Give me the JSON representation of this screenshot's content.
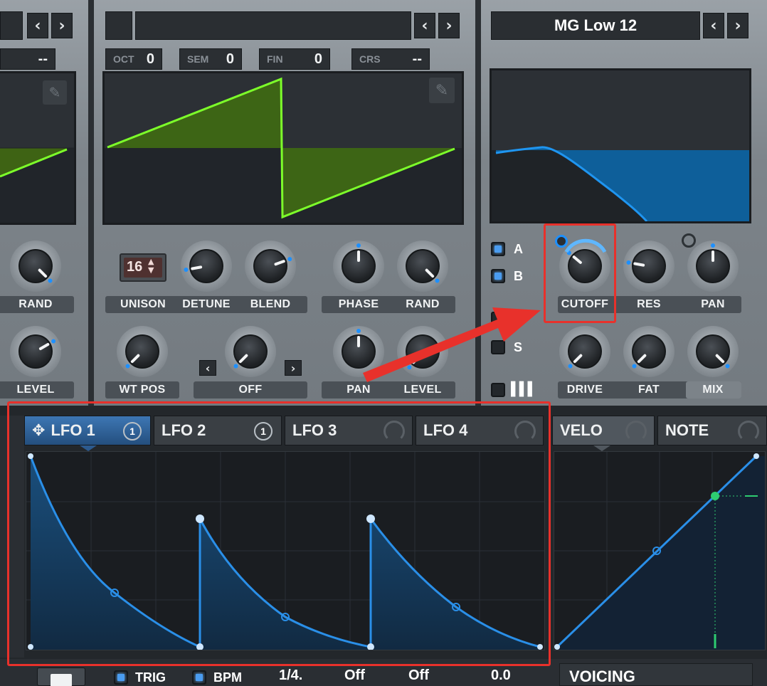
{
  "osc_left": {
    "detail_value": "--",
    "rand_label": "RAND",
    "level_label": "LEVEL"
  },
  "osc_b": {
    "fields": [
      {
        "key": "OCT",
        "value": "0"
      },
      {
        "key": "SEM",
        "value": "0"
      },
      {
        "key": "FIN",
        "value": "0"
      },
      {
        "key": "CRS",
        "value": "--"
      }
    ],
    "unison_value": "16",
    "labels_row1": [
      "UNISON",
      "DETUNE",
      "BLEND",
      "PHASE",
      "RAND"
    ],
    "labels_row2": [
      "WT POS",
      "OFF",
      "PAN",
      "LEVEL"
    ]
  },
  "filter": {
    "preset_name": "MG Low 12",
    "routes": [
      {
        "label": "A",
        "checked": true
      },
      {
        "label": "B",
        "checked": true
      },
      {
        "label": "S",
        "checked": false
      }
    ],
    "labels_row1": [
      "CUTOFF",
      "RES",
      "PAN"
    ],
    "labels_row2": [
      "DRIVE",
      "FAT",
      "MIX"
    ]
  },
  "lfo_tabs": [
    {
      "label": "LFO 1",
      "count": "1",
      "active": true
    },
    {
      "label": "LFO 2",
      "count": "1",
      "active": false
    },
    {
      "label": "LFO 3",
      "count": "",
      "active": false
    },
    {
      "label": "LFO 4",
      "count": "",
      "active": false
    }
  ],
  "mod_tabs": [
    {
      "label": "VELO"
    },
    {
      "label": "NOTE"
    }
  ],
  "bottom_bar": {
    "trig_label": "TRIG",
    "bpm_label": "BPM",
    "rate": "1/4.",
    "value_a": "Off",
    "value_b": "Off",
    "value_c": "0.0",
    "voicing_label": "VOICING"
  },
  "colors": {
    "accent_blue": "#1e90ff",
    "wave_green": "#7dff2a",
    "highlight_red": "#e8312b"
  }
}
